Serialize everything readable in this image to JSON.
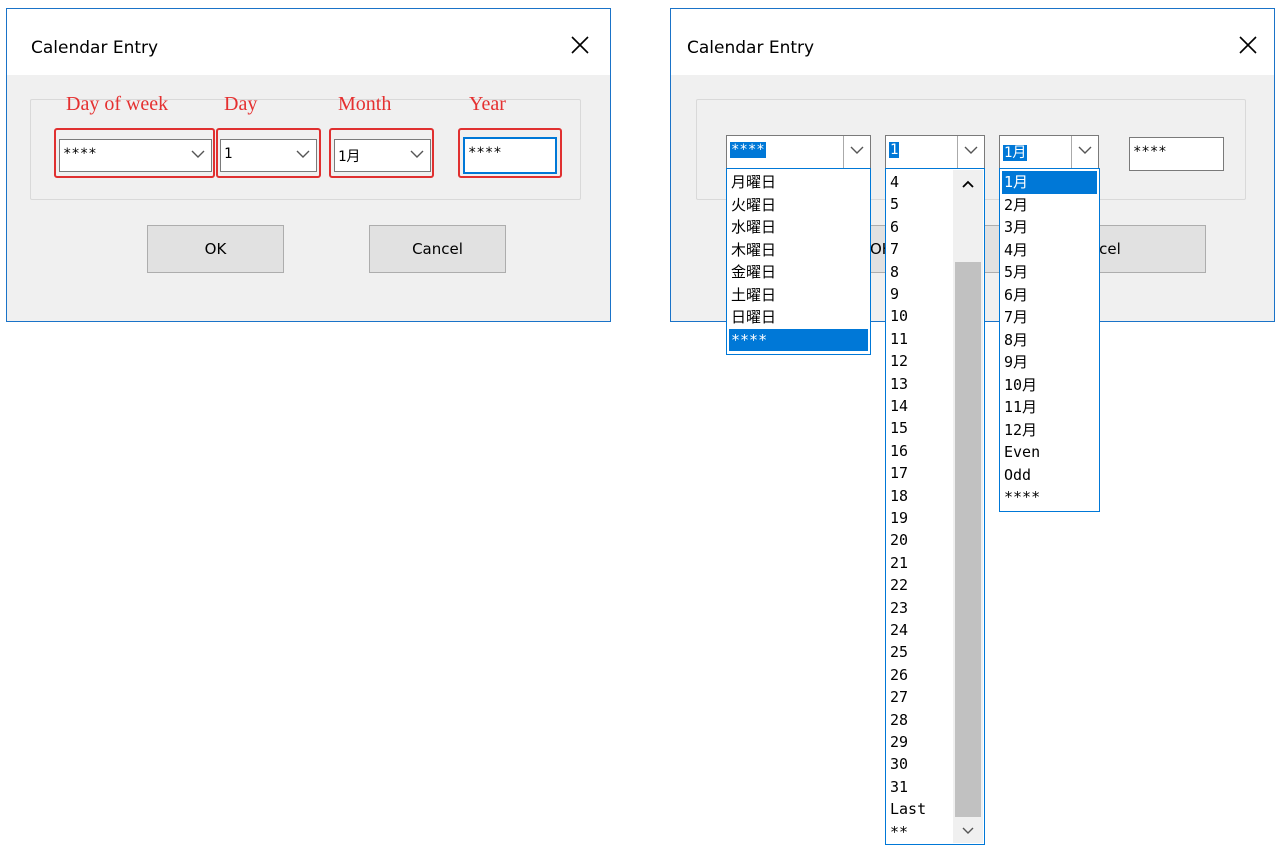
{
  "left_dialog": {
    "title": "Calendar Entry",
    "labels": {
      "day_of_week": "Day of week",
      "day": "Day",
      "month": "Month",
      "year": "Year"
    },
    "fields": {
      "day_of_week": "****",
      "day": "1",
      "month": "1月",
      "year": "****"
    },
    "ok_label": "OK",
    "cancel_label": "Cancel"
  },
  "right_dialog": {
    "title": "Calendar Entry",
    "fields": {
      "day_of_week": "****",
      "day": "1",
      "month": "1月",
      "year": "****"
    },
    "ok_label_partial": "OK",
    "cancel_label_partial": "Cancel"
  },
  "dropdowns": {
    "day_of_week": [
      "月曜日",
      "火曜日",
      "水曜日",
      "木曜日",
      "金曜日",
      "土曜日",
      "日曜日",
      "****"
    ],
    "day_of_week_selected": "****",
    "day": [
      "4",
      "5",
      "6",
      "7",
      "8",
      "9",
      "10",
      "11",
      "12",
      "13",
      "14",
      "15",
      "16",
      "17",
      "18",
      "19",
      "20",
      "21",
      "22",
      "23",
      "24",
      "25",
      "26",
      "27",
      "28",
      "29",
      "30",
      "31",
      "Last",
      "**"
    ],
    "month": [
      "1月",
      "2月",
      "3月",
      "4月",
      "5月",
      "6月",
      "7月",
      "8月",
      "9月",
      "10月",
      "11月",
      "12月",
      "Even",
      "Odd",
      "****"
    ],
    "month_selected": "1月"
  },
  "icons": {
    "close": "close-icon",
    "chevron": "chevron-down-icon",
    "scroll_up": "chevron-up-icon",
    "scroll_down": "chevron-down-icon"
  },
  "colors": {
    "accent": "#0078d7",
    "annotation": "#e53030",
    "dialog_bg": "#f0f0f0",
    "border": "#1a73c8"
  }
}
